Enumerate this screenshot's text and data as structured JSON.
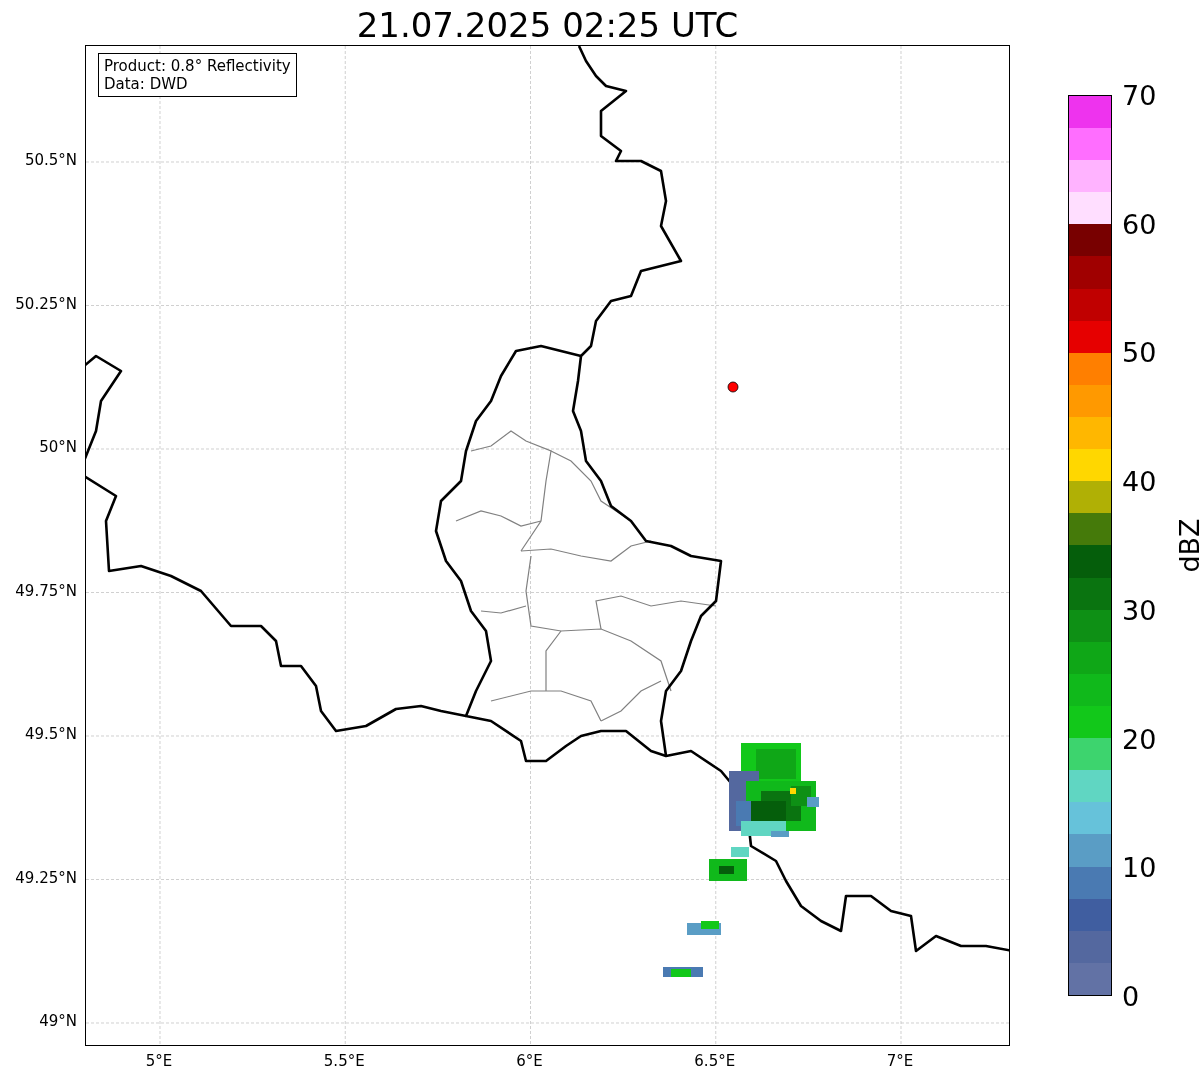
{
  "title": "21.07.2025 02:25 UTC",
  "info_box": {
    "lines": [
      "Product: 0.8° Reflectivity",
      "Data: DWD"
    ]
  },
  "map": {
    "lat_ticks": [
      "50.5°N",
      "50.25°N",
      "50°N",
      "49.75°N",
      "49.5°N",
      "49.25°N",
      "49°N"
    ],
    "lon_ticks": [
      "5°E",
      "5.5°E",
      "6°E",
      "6.5°E",
      "7°E"
    ]
  },
  "colorbar": {
    "label": "dBZ",
    "ticks": [
      "70",
      "60",
      "50",
      "40",
      "30",
      "20",
      "10",
      "0"
    ],
    "bins": [
      {
        "color": "#6272a5"
      },
      {
        "color": "#54689f"
      },
      {
        "color": "#405ea0"
      },
      {
        "color": "#4a7ab2"
      },
      {
        "color": "#5a9dc5"
      },
      {
        "color": "#66c2da"
      },
      {
        "color": "#60d6c2"
      },
      {
        "color": "#3dd46e"
      },
      {
        "color": "#12c81a"
      },
      {
        "color": "#10b91b"
      },
      {
        "color": "#0fa717"
      },
      {
        "color": "#0e9015"
      },
      {
        "color": "#0a7410"
      },
      {
        "color": "#055e0b"
      },
      {
        "color": "#457a0a"
      },
      {
        "color": "#b0b005"
      },
      {
        "color": "#ffd700"
      },
      {
        "color": "#ffb700"
      },
      {
        "color": "#ff9900"
      },
      {
        "color": "#ff7f00"
      },
      {
        "color": "#e60000"
      },
      {
        "color": "#c00000"
      },
      {
        "color": "#a00000"
      },
      {
        "color": "#780000"
      },
      {
        "color": "#ffdeff"
      },
      {
        "color": "#ffb3ff"
      },
      {
        "color": "#ff6eff"
      },
      {
        "color": "#ee33ee"
      }
    ]
  }
}
